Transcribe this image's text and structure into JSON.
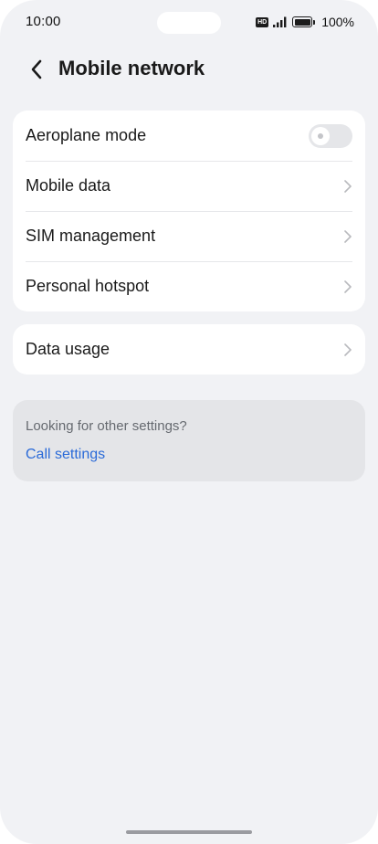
{
  "status_bar": {
    "time": "10:00",
    "hd_label": "HD",
    "battery_percent": "100%",
    "signal_icon": "signal-icon",
    "battery_icon": "battery-icon"
  },
  "header": {
    "title": "Mobile network",
    "back_icon": "back-arrow-icon"
  },
  "settings_group": {
    "items": [
      {
        "label": "Aeroplane mode",
        "control": "toggle",
        "toggle_on": false
      },
      {
        "label": "Mobile data",
        "control": "chevron"
      },
      {
        "label": "SIM management",
        "control": "chevron"
      },
      {
        "label": "Personal hotspot",
        "control": "chevron"
      }
    ]
  },
  "usage_group": {
    "items": [
      {
        "label": "Data usage",
        "control": "chevron"
      }
    ]
  },
  "hint": {
    "text": "Looking for other settings?",
    "link": "Call settings",
    "link_color": "#2a6ad8"
  },
  "colors": {
    "background": "#f1f2f5",
    "card": "#ffffff",
    "hint_card": "#e4e5e8",
    "toggle_off": "#e5e6e9"
  }
}
